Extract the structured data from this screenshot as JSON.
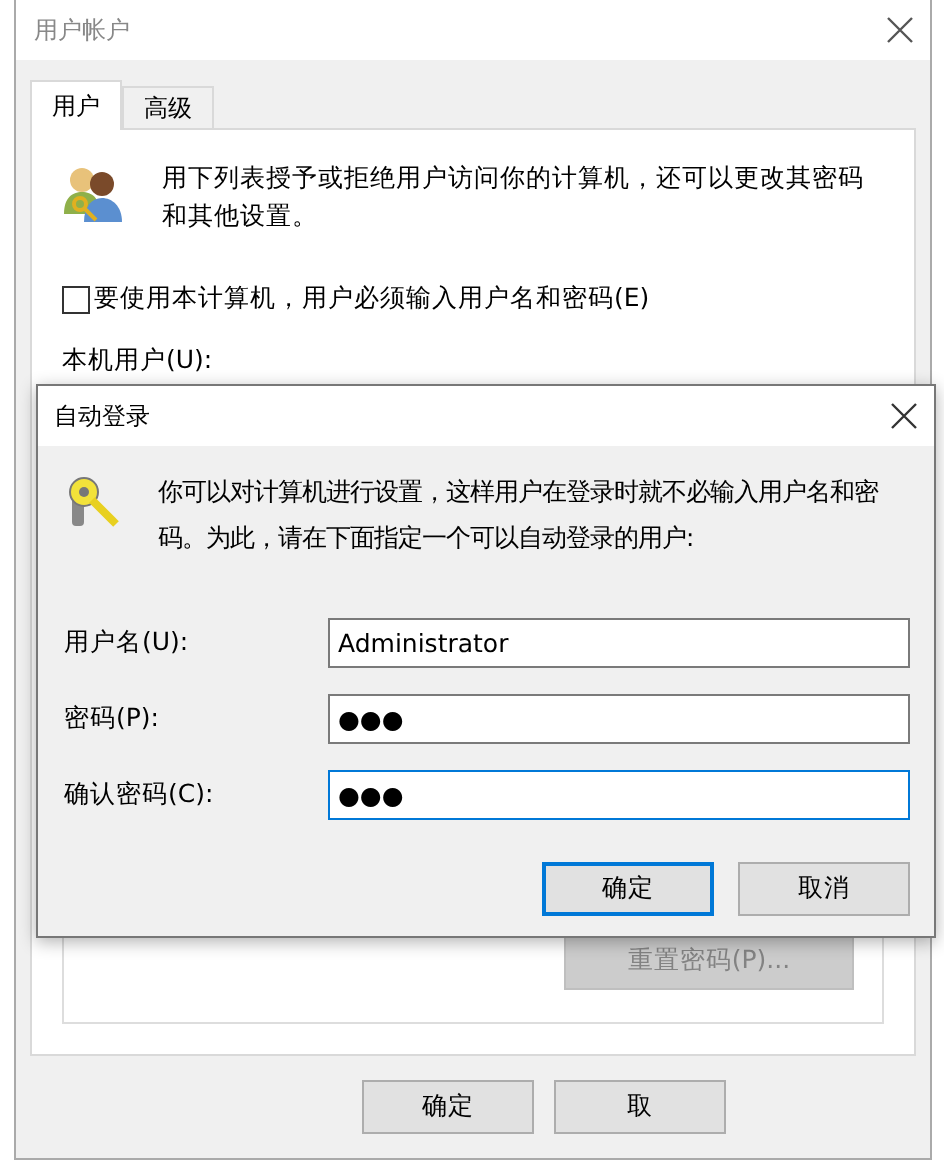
{
  "window": {
    "title": "用户帐户"
  },
  "tabs": [
    {
      "label": "用户",
      "selected": true
    },
    {
      "label": "高级",
      "selected": false
    }
  ],
  "users_panel": {
    "description": "用下列表授予或拒绝用户访问你的计算机，还可以更改其密码和其他设置。",
    "require_password": {
      "label": "要使用本计算机，用户必须输入用户名和密码(E)",
      "checked": false
    },
    "users_label": "本机用户(U):",
    "reset_button": {
      "label": "重置密码(P)...",
      "disabled": true
    }
  },
  "buttons": [
    {
      "label": "确定"
    },
    {
      "label": "取"
    }
  ],
  "dialog": {
    "title": "自动登录",
    "description": "你可以对计算机进行设置，这样用户在登录时就不必输入用户名和密码。为此，请在下面指定一个可以自动登录的用户:",
    "fields": [
      {
        "label": "用户名(U):",
        "value": "Administrator",
        "focused": false
      },
      {
        "label": "密码(P):",
        "value": "●●●",
        "focused": false
      },
      {
        "label": "确认密码(C):",
        "value": "●●●",
        "focused": true
      }
    ],
    "buttons": [
      {
        "label": "确定",
        "default": true
      },
      {
        "label": "取消",
        "default": false
      }
    ]
  }
}
